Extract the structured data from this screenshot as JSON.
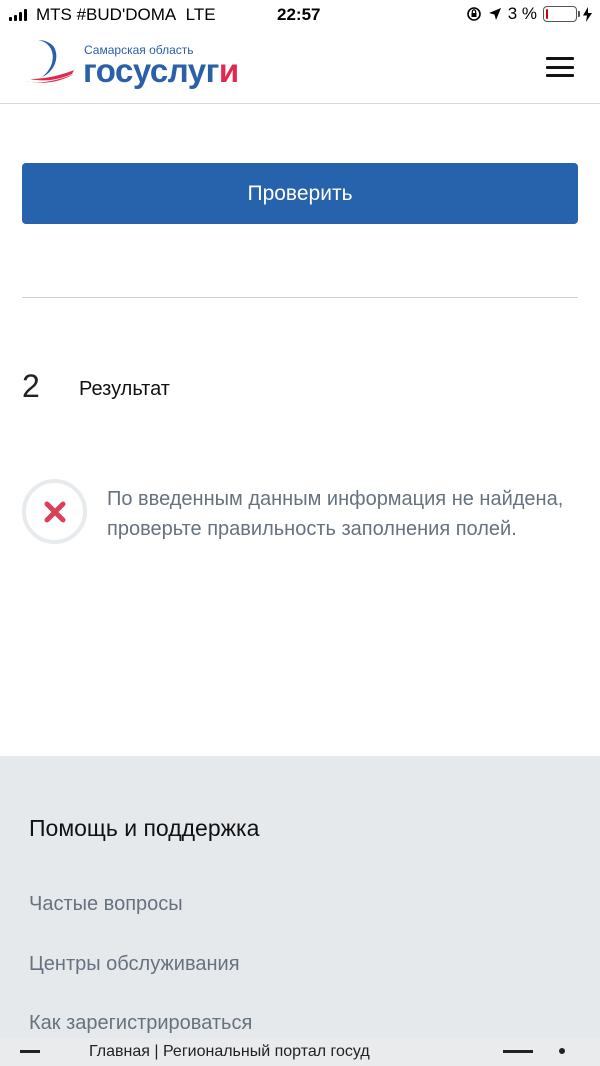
{
  "status_bar": {
    "carrier": "MTS #BUD'DOMA",
    "network": "LTE",
    "time": "22:57",
    "battery": "3 %",
    "battery_level": 0.03
  },
  "header": {
    "region": "Самарская область",
    "brand_main": "госуслуг",
    "brand_accent": "и",
    "brand_color": "#2a5fa9",
    "accent_color": "#e0294f",
    "menu_icon": "hamburger-icon"
  },
  "form": {
    "check_label": "Проверить",
    "accent": "#2762ad"
  },
  "result": {
    "step_number": "2",
    "step_title": "Результат",
    "icon": "error-x-icon",
    "icon_color": "#d9415a",
    "message": "По введенным данным информация не найдена, проверьте правильность заполнения полей."
  },
  "footer": {
    "title": "Помощь и поддержка",
    "links": [
      "Частые вопросы",
      "Центры обслуживания",
      "Как зарегистрироваться"
    ]
  },
  "browser_bar": {
    "page_title": "Главная | Региональный портал госуд"
  }
}
